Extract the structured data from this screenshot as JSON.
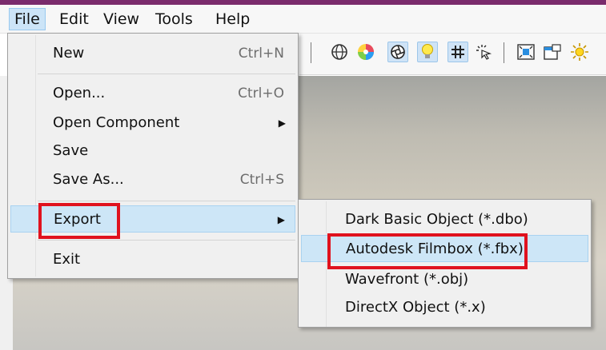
{
  "menubar": {
    "items": [
      {
        "label": "File",
        "active": true
      },
      {
        "label": "Edit"
      },
      {
        "label": "View"
      },
      {
        "label": "Tools"
      },
      {
        "label": "Help"
      }
    ]
  },
  "toolbar": {
    "icons": [
      "globe-icon",
      "color-wheel-icon",
      "aperture-icon",
      "lightbulb-icon",
      "grid-icon",
      "magic-cursor-icon",
      "fit-view-icon",
      "window-properties-icon",
      "sun-icon"
    ],
    "selected": [
      "aperture-icon",
      "lightbulb-icon",
      "grid-icon"
    ]
  },
  "file_menu": {
    "items": [
      {
        "label": "New",
        "shortcut": "Ctrl+N"
      },
      {
        "label": "Open...",
        "shortcut": "Ctrl+O"
      },
      {
        "label": "Open Component",
        "submenu": true
      },
      {
        "label": "Save"
      },
      {
        "label": "Save As...",
        "shortcut": "Ctrl+S"
      },
      {
        "label": "Export",
        "submenu": true,
        "highlighted": true
      },
      {
        "label": "Exit"
      }
    ]
  },
  "export_menu": {
    "items": [
      {
        "label": "Dark Basic Object (*.dbo)"
      },
      {
        "label": "Autodesk Filmbox (*.fbx)",
        "highlighted": true
      },
      {
        "label": "Wavefront (*.obj)"
      },
      {
        "label": "DirectX Object (*.x)"
      }
    ]
  },
  "annotations": {
    "highlight_color": "#e0121e",
    "boxed": [
      "Export",
      "Autodesk Filmbox (*.fbx)"
    ]
  },
  "colors": {
    "menu_highlight": "#cde6f7",
    "menu_background": "#f0f0f0",
    "title_accent": "#7a2b6c"
  }
}
